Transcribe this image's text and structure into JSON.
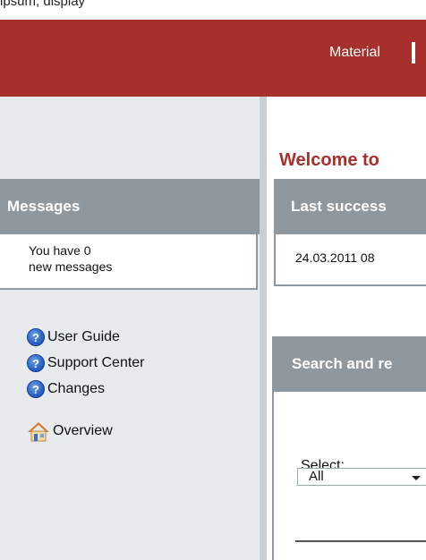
{
  "topbar": {
    "clipped_text": "ipsum, display"
  },
  "header": {
    "nav_label": "Material",
    "separator": "|"
  },
  "welcome": {
    "text": "Welcome to"
  },
  "messages": {
    "title": "Messages",
    "line1": "You have 0",
    "line2": "new messages"
  },
  "help_links": [
    {
      "label": "User Guide",
      "icon": "help-icon"
    },
    {
      "label": "Support Center",
      "icon": "help-icon"
    },
    {
      "label": "Changes",
      "icon": "help-icon"
    }
  ],
  "overview": {
    "label": "Overview",
    "icon": "home-icon"
  },
  "last_success": {
    "title": "Last success",
    "value": "24.03.2011 08"
  },
  "search": {
    "title": "Search and re",
    "select_label": "Select:",
    "select_value": "All"
  },
  "colors": {
    "header_bg": "#a8302c",
    "sidebar_bg": "#e7ebee",
    "panel_head_bg": "#8f989f",
    "welcome_text": "#a8302c"
  }
}
